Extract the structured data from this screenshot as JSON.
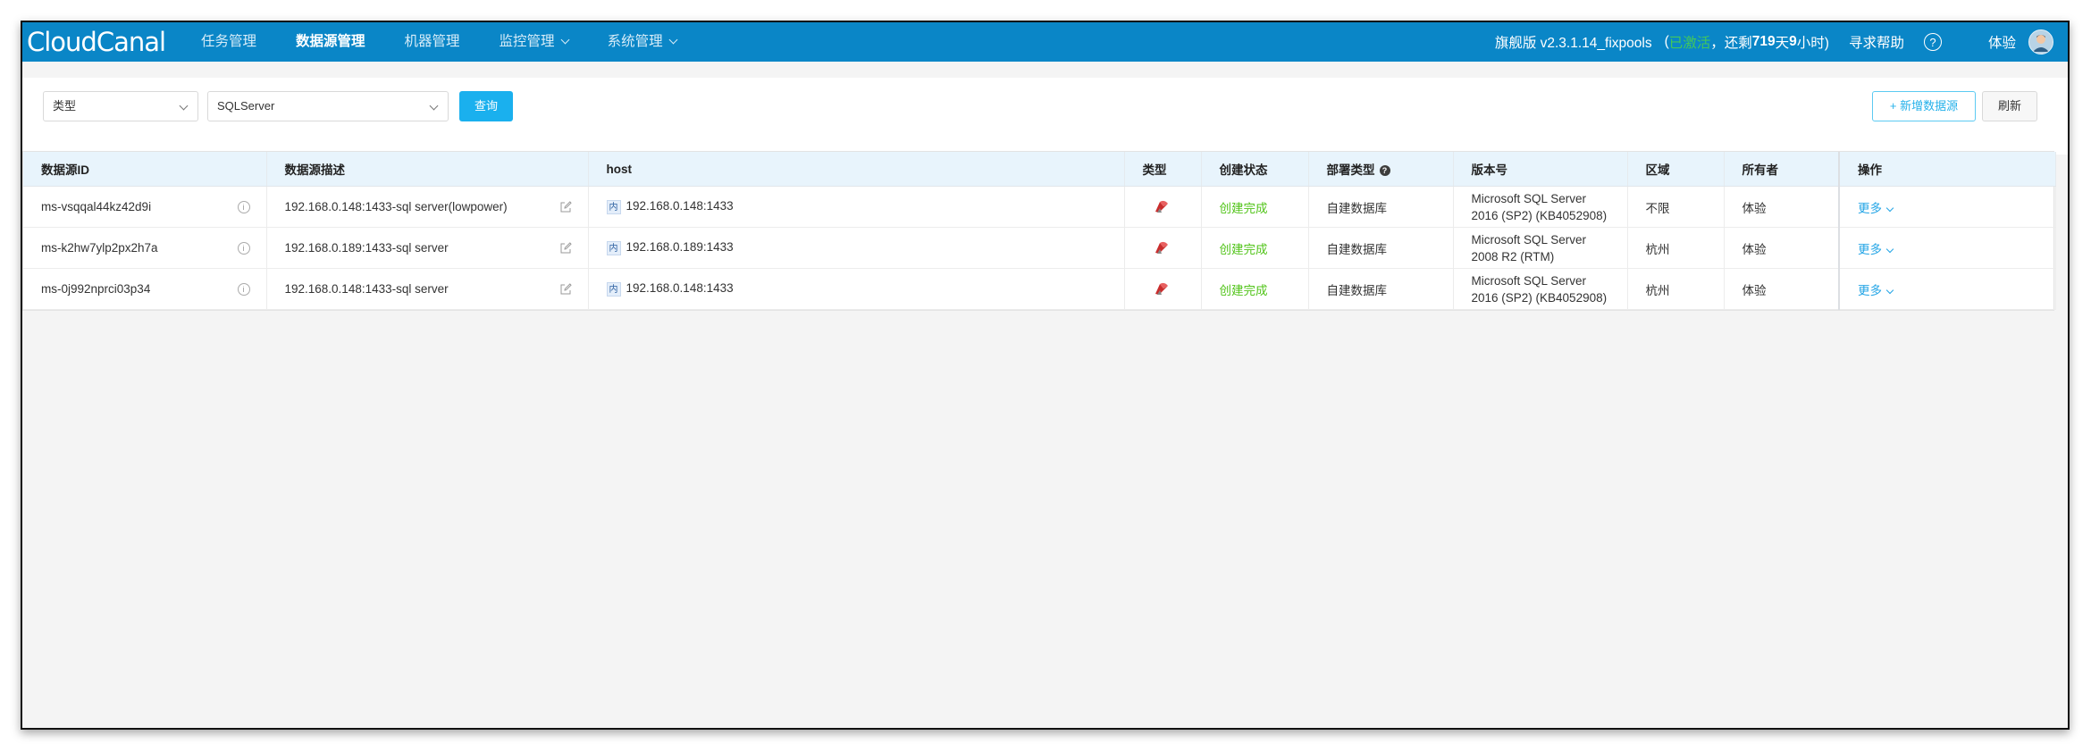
{
  "app": {
    "logo": "CloudCanal",
    "nav": [
      {
        "label": "任务管理",
        "has_dropdown": false,
        "active": false
      },
      {
        "label": "数据源管理",
        "has_dropdown": false,
        "active": true
      },
      {
        "label": "机器管理",
        "has_dropdown": false,
        "active": false
      },
      {
        "label": "监控管理",
        "has_dropdown": true,
        "active": false
      },
      {
        "label": "系统管理",
        "has_dropdown": true,
        "active": false
      }
    ],
    "version": "旗舰版 v2.3.1.14_fixpools",
    "license_open": "(",
    "license_status": "已激活",
    "license_remaining_prefix": "，还剩",
    "license_days": "719",
    "license_days_unit": "天",
    "license_hours": "9",
    "license_hours_unit": "小时)",
    "help": "寻求帮助",
    "help_icon": "?",
    "user": "体验"
  },
  "filters": {
    "type_select": "类型",
    "db_select": "SQLServer",
    "query_button": "查询",
    "add_button": "+ 新增数据源",
    "refresh_button": "刷新"
  },
  "table": {
    "headers": {
      "id": "数据源ID",
      "desc": "数据源描述",
      "host": "host",
      "type": "类型",
      "status": "创建状态",
      "deploy": "部署类型",
      "version": "版本号",
      "region": "区域",
      "owner": "所有者",
      "ops": "操作"
    },
    "host_badge": "内",
    "more_label": "更多",
    "rows": [
      {
        "id": "ms-vsqqal44kz42d9i",
        "desc": "192.168.0.148:1433-sql server(lowpower)",
        "host": "192.168.0.148:1433",
        "type_icon": "sqlserver-icon",
        "status": "创建完成",
        "deploy": "自建数据库",
        "version": "Microsoft SQL Server 2016 (SP2) (KB4052908)",
        "region": "不限",
        "owner": "体验"
      },
      {
        "id": "ms-k2hw7ylp2px2h7a",
        "desc": "192.168.0.189:1433-sql server",
        "host": "192.168.0.189:1433",
        "type_icon": "sqlserver-icon",
        "status": "创建完成",
        "deploy": "自建数据库",
        "version": "Microsoft SQL Server 2008 R2 (RTM)",
        "region": "杭州",
        "owner": "体验"
      },
      {
        "id": "ms-0j992nprci03p34",
        "desc": "192.168.0.148:1433-sql server",
        "host": "192.168.0.148:1433",
        "type_icon": "sqlserver-icon",
        "status": "创建完成",
        "deploy": "自建数据库",
        "version": "Microsoft SQL Server 2016 (SP2) (KB4052908)",
        "region": "杭州",
        "owner": "体验"
      }
    ]
  },
  "colors": {
    "topbar": "#0a86c7",
    "accent": "#1ab0ee",
    "success": "#52c41a",
    "license_green": "#43c85a"
  }
}
